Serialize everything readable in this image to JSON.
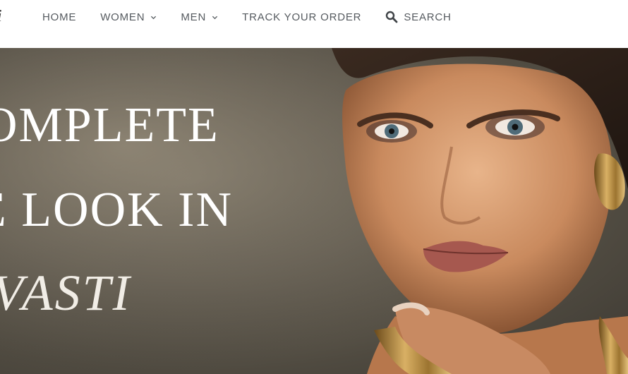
{
  "header": {
    "logo_fragment": "i",
    "nav": [
      {
        "label": "HOME",
        "has_dropdown": false
      },
      {
        "label": "WOMEN",
        "has_dropdown": true
      },
      {
        "label": "MEN",
        "has_dropdown": true
      },
      {
        "label": "TRACK YOUR ORDER",
        "has_dropdown": false
      }
    ],
    "search_label": "SEARCH",
    "search_icon": "search-icon"
  },
  "hero": {
    "line1": "OMPLETE",
    "line2": "E LOOK IN",
    "line3": "IVASTI",
    "image_description": "model-with-gold-jewelry"
  },
  "colors": {
    "nav_text": "#555a5f",
    "hero_text": "#ffffff",
    "hero_bg": "#6f685b"
  }
}
